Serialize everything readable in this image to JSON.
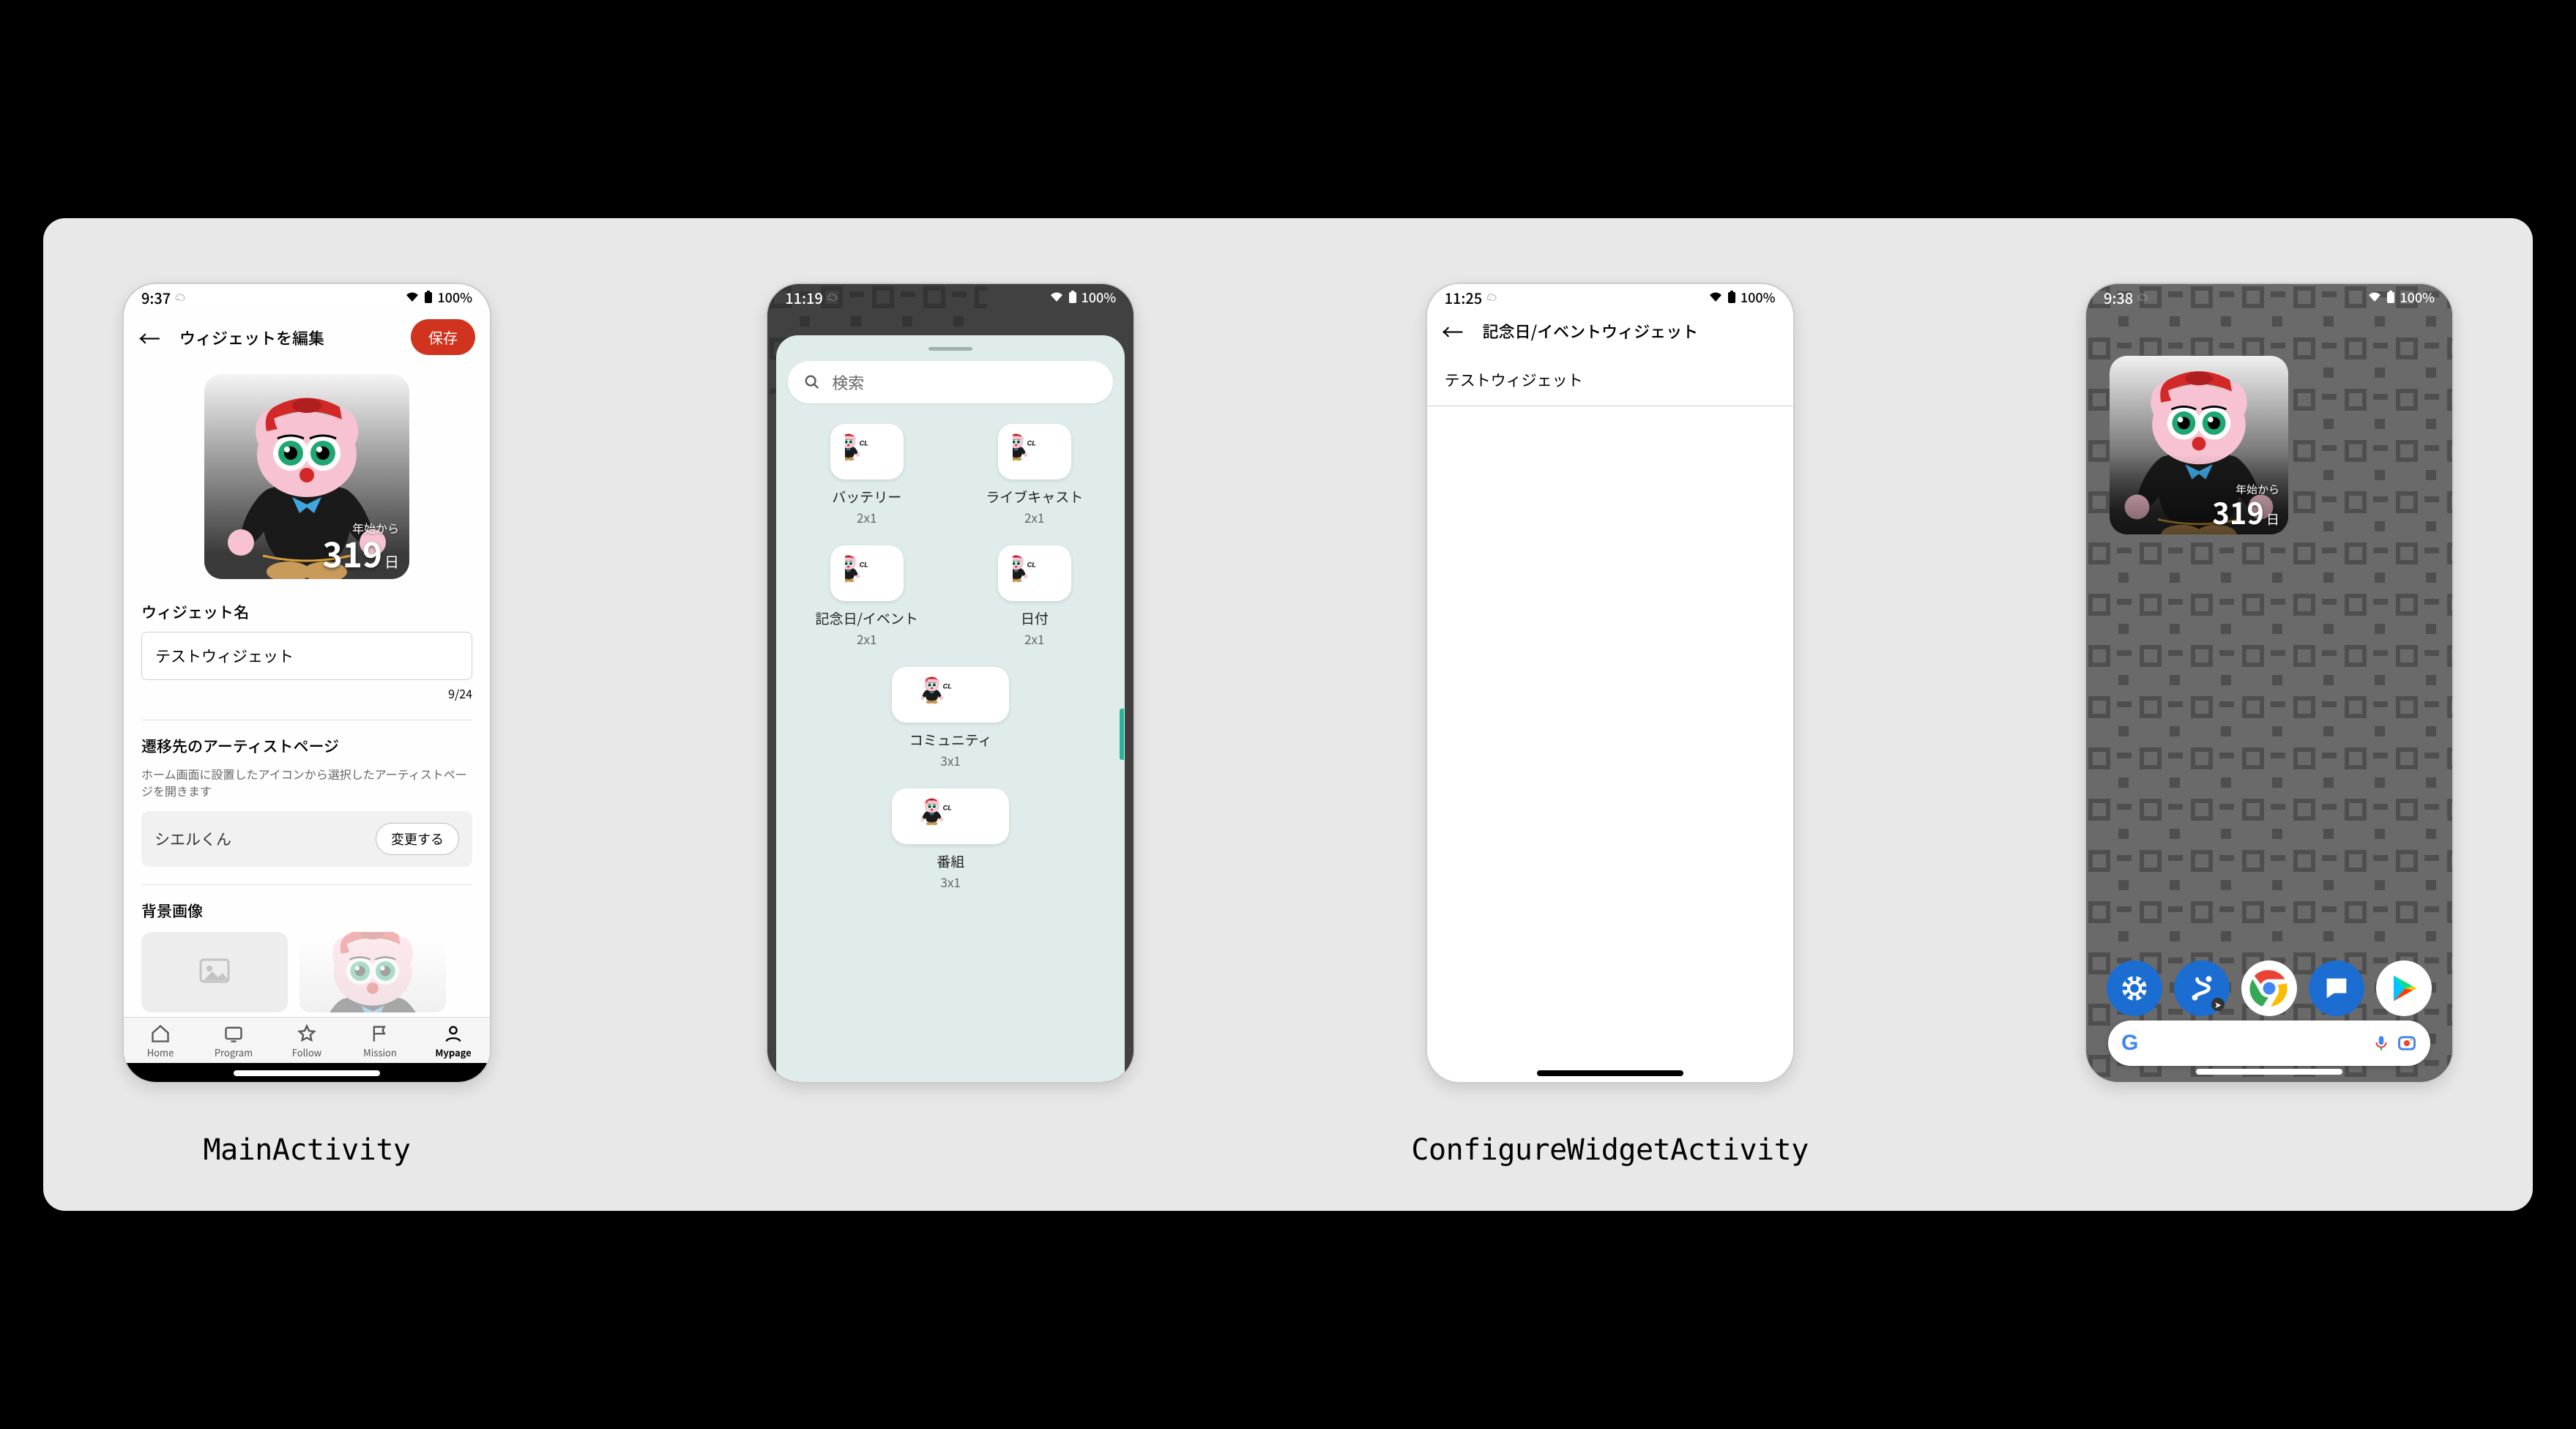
{
  "labels": {
    "main_activity": "MainActivity",
    "configure_activity": "ConfigureWidgetActivity"
  },
  "phone1": {
    "time": "9:37",
    "battery": "100%",
    "toolbar_title": "ウィジェットを編集",
    "save": "保存",
    "preview": {
      "from": "年始から",
      "count": "319",
      "unit": "日"
    },
    "name_label": "ウィジェット名",
    "name_value": "テストウィジェット",
    "name_counter": "9/24",
    "artist_label": "遷移先のアーティストページ",
    "artist_sub": "ホーム画面に設置したアイコンから選択したアーティストページを開きます",
    "artist_name": "シエルくん",
    "change": "変更する",
    "bg_label": "背景画像",
    "nav": [
      "Home",
      "Program",
      "Follow",
      "Mission",
      "Mypage"
    ]
  },
  "phone2": {
    "time": "11:19",
    "battery": "100%",
    "search_placeholder": "検索",
    "widgets": [
      {
        "name": "バッテリー",
        "size": "2x1"
      },
      {
        "name": "ライブキャスト",
        "size": "2x1"
      },
      {
        "name": "記念日/イベント",
        "size": "2x1"
      },
      {
        "name": "日付",
        "size": "2x1"
      },
      {
        "name": "コミュニティ",
        "size": "3x1"
      },
      {
        "name": "番組",
        "size": "3x1"
      }
    ]
  },
  "phone3": {
    "time": "11:25",
    "battery": "100%",
    "toolbar_title": "記念日/イベントウィジェット",
    "item": "テストウィジェット"
  },
  "phone4": {
    "time": "9:38",
    "battery": "100%",
    "widget": {
      "from": "年始から",
      "count": "319",
      "unit": "日"
    }
  }
}
